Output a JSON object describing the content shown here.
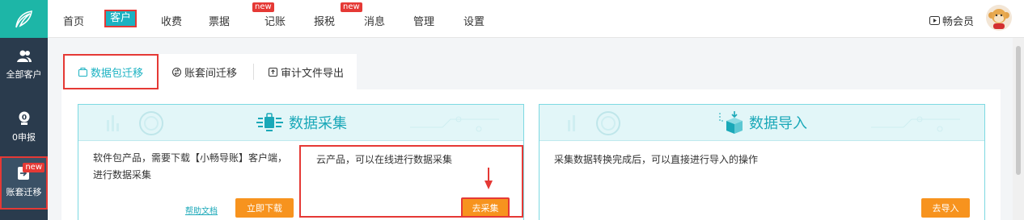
{
  "sidebar": {
    "items": [
      {
        "label": "全部客户"
      },
      {
        "label": "0申报"
      },
      {
        "label": "账套迁移",
        "badge": "new"
      }
    ]
  },
  "topnav": {
    "items": [
      {
        "label": "首页"
      },
      {
        "label": "客户"
      },
      {
        "label": "收费"
      },
      {
        "label": "票据",
        "badge": "new"
      },
      {
        "label": "记账"
      },
      {
        "label": "报税",
        "badge": "new"
      },
      {
        "label": "消息"
      },
      {
        "label": "管理"
      },
      {
        "label": "设置"
      }
    ],
    "vip_label": "畅会员"
  },
  "tabs": [
    {
      "label": "数据包迁移"
    },
    {
      "label": "账套间迁移"
    },
    {
      "label": "审计文件导出"
    }
  ],
  "cards": {
    "collect": {
      "title": "数据采集",
      "left_text": "软件包产品，需要下载【小畅导账】客户端，进行数据采集",
      "help_link": "帮助文档",
      "download_button": "立即下载",
      "right_text": "云产品，可以在线进行数据采集",
      "collect_button": "去采集"
    },
    "import": {
      "title": "数据导入",
      "text": "采集数据转换完成后，可以直接进行导入的操作",
      "import_button": "去导入"
    }
  },
  "colors": {
    "accent": "#1bb2c2",
    "orange": "#f7931e",
    "highlight": "#e53935",
    "sidebar": "#2a3b4d"
  }
}
